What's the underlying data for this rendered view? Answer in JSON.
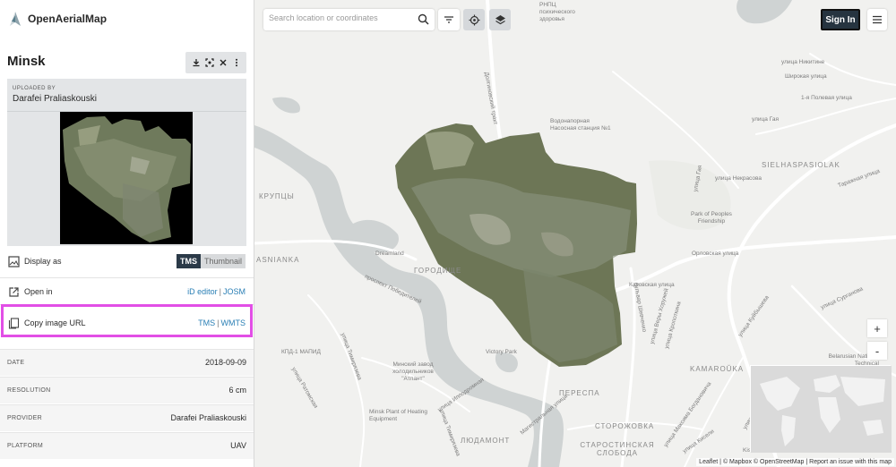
{
  "brand": {
    "name": "OpenAerialMap"
  },
  "image": {
    "title": "Minsk",
    "uploaded_by_label": "UPLOADED BY",
    "uploader": "Darafei Praliaskouski"
  },
  "panel": {
    "display_as": {
      "label": "Display as",
      "options": [
        "TMS",
        "Thumbnail"
      ],
      "selected": "TMS"
    },
    "open_in": {
      "label": "Open in",
      "links": [
        "iD editor",
        "JOSM"
      ],
      "separator": "|"
    },
    "copy_url": {
      "label": "Copy image URL",
      "links": [
        "TMS",
        "WMTS"
      ],
      "separator": "|"
    },
    "details": [
      {
        "key": "DATE",
        "value": "2018-09-09"
      },
      {
        "key": "RESOLUTION",
        "value": "6 cm"
      },
      {
        "key": "PROVIDER",
        "value": "Darafei Praliaskouski"
      },
      {
        "key": "PLATFORM",
        "value": "UAV"
      }
    ]
  },
  "map": {
    "search_placeholder": "Search location or coordinates",
    "sign_in": "Sign In",
    "zoom_in": "+",
    "zoom_out": "-",
    "attribution": {
      "leaflet": "Leaflet",
      "mapbox": "© Mapbox",
      "osm": "© OpenStreetMap",
      "report": "Report an issue with this map",
      "sep": "|"
    },
    "labels": {
      "l1": "улица Никитинe",
      "l2": "Широкая улица",
      "l3": "1-я Полевая улица",
      "l4": "улица Гая",
      "l5": "РНПЦ психического здоровья",
      "l6": "Водонапорная Насосная станция №1",
      "l7": "Долгиновский тракт",
      "l8": "SIELHASPASIOLAK",
      "l9": "улица Некрасова",
      "l10": "Таражная улица",
      "l11": "КРУПЦЫ",
      "l12": "Park of Peoples Friendship",
      "l13": "улица Гая",
      "l14": "Орловская улица",
      "l15": "ASNIANKA",
      "l16": "Dreamland",
      "l17": "ГОРОДИЩЕ",
      "l18": "Каховская улица",
      "l19": "улица Кропоткина",
      "l20": "улица Куйбышева",
      "l21": "улица Сурганова",
      "l22": "проспект Победителей",
      "l23": "бульвар Шевченко",
      "l24": "улица Веры Хоружей",
      "l25": "КПД-1 МАПИД",
      "l26": "Victory Park",
      "l27": "Минский завод холодильников \"Атлант\"",
      "l28": "KAMAROŬKA",
      "l29": "Belarusian National Technical",
      "l30": "улица Тимирязева",
      "l31": "улица Ратомская",
      "l32": "улица Ипподромная",
      "l33": "ПЕРЕСПА",
      "l34": "Minsk Plant of Heating Equipment",
      "l35": "улица Тимирязева",
      "l36": "Магистральная улица",
      "l37": "СТОРОЖОВКА",
      "l38": "ЛЮДАМОНТ",
      "l39": "СТАРОСТИНСКАЯ СЛОБОДА",
      "l40": "улица Максима Богдановича",
      "l41": "улица Кисели",
      "l42": "улица Кольцова",
      "l43": "Kiseleva St"
    },
    "colors": {
      "river": "#cfd3d3",
      "road": "#ffffff",
      "highlight": "#e24fe6",
      "signin": "#263440"
    }
  }
}
